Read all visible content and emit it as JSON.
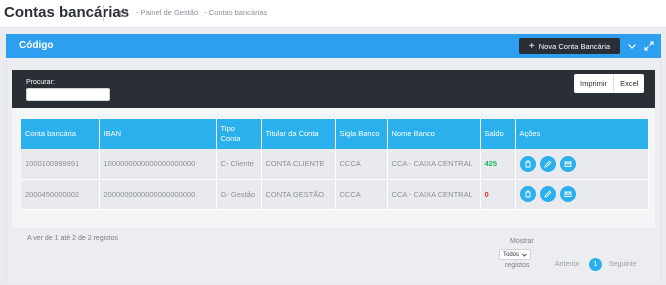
{
  "header": {
    "title": "Contas bancárias",
    "breadcrumb": [
      "- Painel de Gestão",
      "- Contas bancárias"
    ]
  },
  "card": {
    "title": "Código",
    "new_button_label": "Nova Conta Bancária",
    "icons": [
      "plus-icon",
      "chevron-down-icon",
      "expand-icon"
    ]
  },
  "toolbar": {
    "search_label": "Procurar:",
    "search_value": "",
    "print_label": "Imprimir",
    "excel_label": "Excel"
  },
  "table": {
    "columns": [
      "Conta bancária",
      "IBAN",
      "Tipo Conta",
      "Titular da Conta",
      "Sigla Banco",
      "Nome Banco",
      "Saldo",
      "Ações"
    ],
    "rows": [
      {
        "conta": "1000100999991",
        "iban": "1000000000000000000000",
        "tipo": "C- Cliente",
        "titular": "CONTA CLIENTE",
        "sigla": "CCCA",
        "banco": "CCA - CAIXA CENTRAL",
        "saldo": "425"
      },
      {
        "conta": "2000450000002",
        "iban": "2000000000000000000000",
        "tipo": "G- Gestão",
        "titular": "CONTA GESTÃO",
        "sigla": "CCCA",
        "banco": "CCA - CAIXA CENTRAL",
        "saldo": "0"
      }
    ],
    "action_icons": [
      "delete-icon",
      "edit-icon",
      "email-icon"
    ]
  },
  "footer": {
    "info": "A ver de 1 até 2 de 2 registos",
    "show_label": "Mostrar",
    "page_size": "Todos",
    "records_label": "registos",
    "prev_label": "Anterior",
    "current_page": "1",
    "next_label": "Seguinte"
  },
  "colors": {
    "accent": "#2ab0ec",
    "header_blue": "#2e9ff0",
    "dark": "#2a2e35",
    "positive": "#1fb86b",
    "negative": "#e0342f"
  }
}
